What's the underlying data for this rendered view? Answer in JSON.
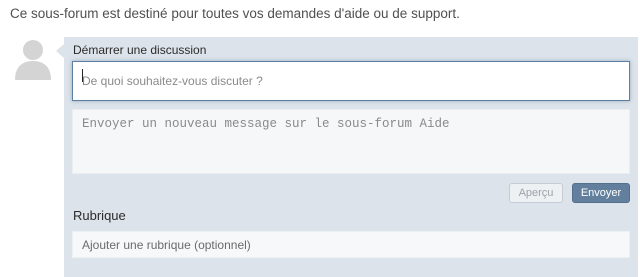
{
  "forum": {
    "description": "Ce sous-forum est destiné pour toutes vos demandes d'aide ou de support."
  },
  "discussion": {
    "start_label": "Démarrer une discussion",
    "title_placeholder": "De quoi souhaitez-vous discuter ?",
    "message_placeholder": "Envoyer un nouveau message sur le sous-forum Aide",
    "preview_label": "Aperçu",
    "send_label": "Envoyer"
  },
  "rubric": {
    "label": "Rubrique",
    "placeholder": "Ajouter une rubrique (optionnel)"
  },
  "colors": {
    "panel_bg": "#dde3ea",
    "accent": "#62809e",
    "focus_border": "#5d7f9f"
  },
  "icons": {
    "avatar": "default-avatar-icon",
    "caret": "text-cursor"
  }
}
